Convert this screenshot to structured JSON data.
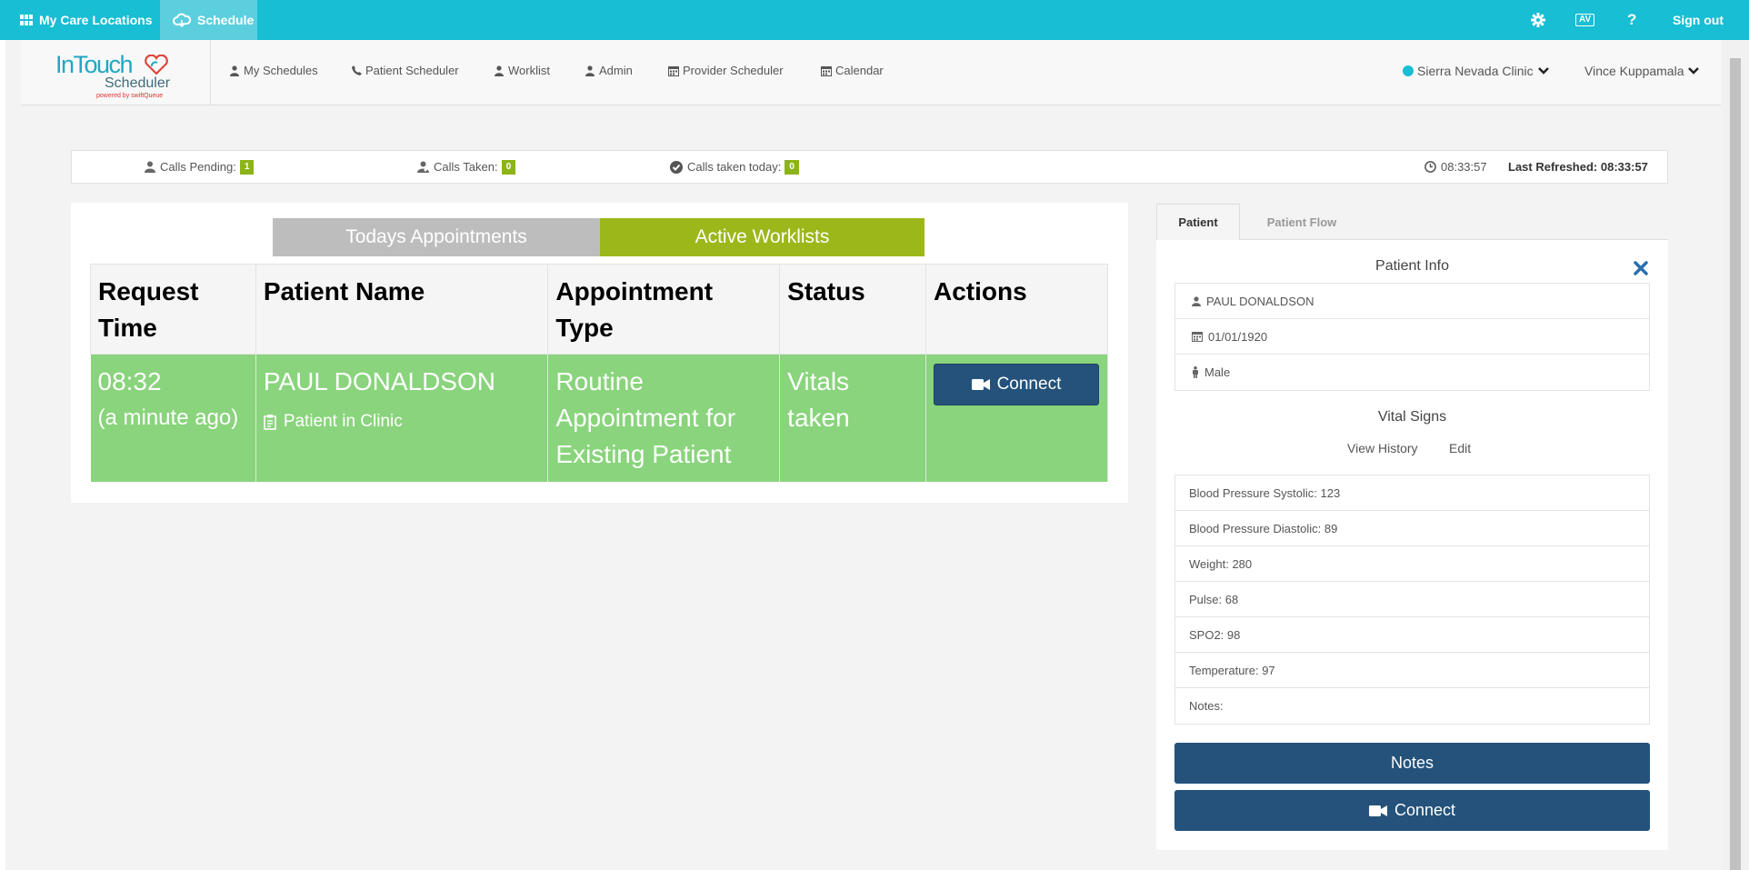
{
  "topbar": {
    "care_locations": "My Care Locations",
    "schedule": "Schedule",
    "av_label": "AV",
    "help_label": "?",
    "sign_out": "Sign out"
  },
  "logo": {
    "brand": "InTouch",
    "product": "Scheduler",
    "tagline": "powered by swiftQueue"
  },
  "nav": {
    "my_schedules": "My Schedules",
    "patient_scheduler": "Patient Scheduler",
    "worklist": "Worklist",
    "admin": "Admin",
    "provider_scheduler": "Provider Scheduler",
    "calendar": "Calendar"
  },
  "header_right": {
    "clinic": "Sierra Nevada Clinic",
    "user": "Vince Kuppamala"
  },
  "stats": {
    "calls_pending_label": "Calls Pending:",
    "calls_pending_value": "1",
    "calls_taken_label": "Calls Taken:",
    "calls_taken_value": "0",
    "calls_today_label": "Calls taken today:",
    "calls_today_value": "0",
    "clock": "08:33:57",
    "last_refreshed": "Last Refreshed: 08:33:57"
  },
  "main": {
    "tab_today": "Todays Appointments",
    "tab_active": "Active Worklists",
    "columns": [
      "Request Time",
      "Patient Name",
      "Appointment Type",
      "Status",
      "Actions"
    ],
    "row": {
      "time": "08:32",
      "time_ago": "(a minute ago)",
      "patient": "PAUL DONALDSON",
      "patient_status": "Patient in Clinic",
      "appointment_type": "Routine Appointment for Existing Patient",
      "status": "Vitals taken",
      "action": "Connect"
    }
  },
  "right": {
    "tab_patient": "Patient",
    "tab_flow": "Patient Flow",
    "patient_info_title": "Patient Info",
    "patient_name": "PAUL DONALDSON",
    "dob": "01/01/1920",
    "gender": "Male",
    "vitals_title": "Vital Signs",
    "view_history": "View History",
    "edit": "Edit",
    "vitals": [
      "Blood Pressure Systolic: 123",
      "Blood Pressure Diastolic: 89",
      "Weight: 280",
      "Pulse: 68",
      "SPO2: 98",
      "Temperature: 97",
      "Notes:"
    ],
    "notes_button": "Notes",
    "connect_button": "Connect"
  },
  "colors": {
    "topbar": "#18bed3",
    "tab_active": "#9cb71a",
    "tab_inactive": "#bdbdbd",
    "row_green": "#89d47c",
    "button_navy": "#24527a",
    "close_blue": "#2a6fb0"
  }
}
